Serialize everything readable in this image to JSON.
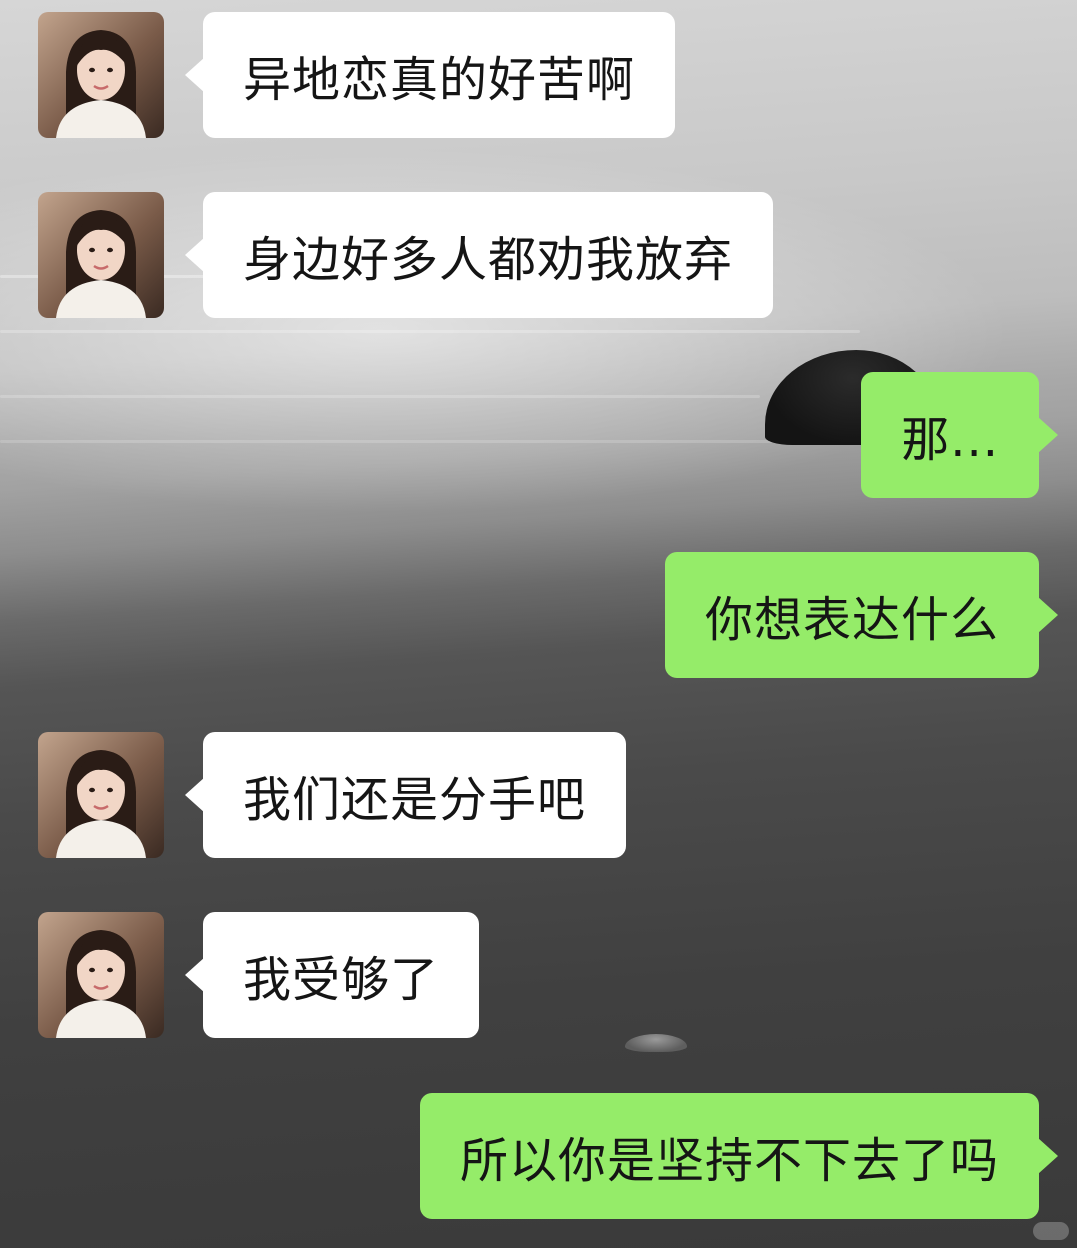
{
  "chat": {
    "messages": [
      {
        "side": "incoming",
        "text": "异地恋真的好苦啊"
      },
      {
        "side": "incoming",
        "text": "身边好多人都劝我放弃"
      },
      {
        "side": "outgoing",
        "text": "那..."
      },
      {
        "side": "outgoing",
        "text": "你想表达什么"
      },
      {
        "side": "incoming",
        "text": "我们还是分手吧"
      },
      {
        "side": "incoming",
        "text": "我受够了"
      },
      {
        "side": "outgoing",
        "text": "所以你是坚持不下去了吗"
      }
    ]
  },
  "colors": {
    "incoming_bubble": "#ffffff",
    "outgoing_bubble": "#95ec69",
    "text": "#151515"
  },
  "icons": {
    "avatar": "user-avatar-photo"
  }
}
